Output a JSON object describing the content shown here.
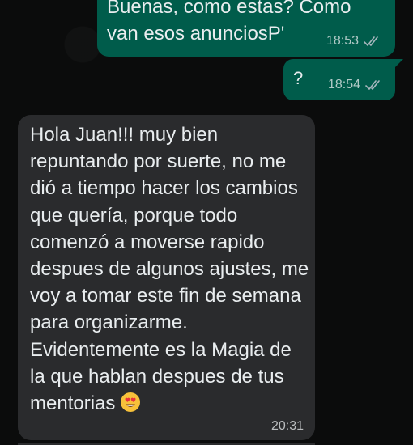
{
  "chat": {
    "messages": [
      {
        "direction": "outgoing",
        "text": "Buenas, como estas? Como\nvan esos anunciosP'",
        "time": "18:53",
        "status": "read-ticks"
      },
      {
        "direction": "outgoing",
        "text": "?",
        "time": "18:54",
        "status": "read-ticks"
      },
      {
        "direction": "incoming",
        "text": "Hola Juan!!! muy bien repuntando por suerte, no me dió a tiempo hacer los cambios que quería, porque todo comenzó a moverse rapido despues de algunos ajustes, me voy a tomar este fin de semana para organizarme. Evidentemente es la Magia de la que hablan despues de tus mentorias",
        "emoji": "heart-eyes-emoji",
        "time": "20:31"
      }
    ]
  },
  "colors": {
    "background": "#0b0c0c",
    "outgoing_bubble": "#005c4b",
    "incoming_bubble": "#2a2b2d",
    "text": "#e9edef",
    "read_ticks": "#a9b8bf"
  }
}
